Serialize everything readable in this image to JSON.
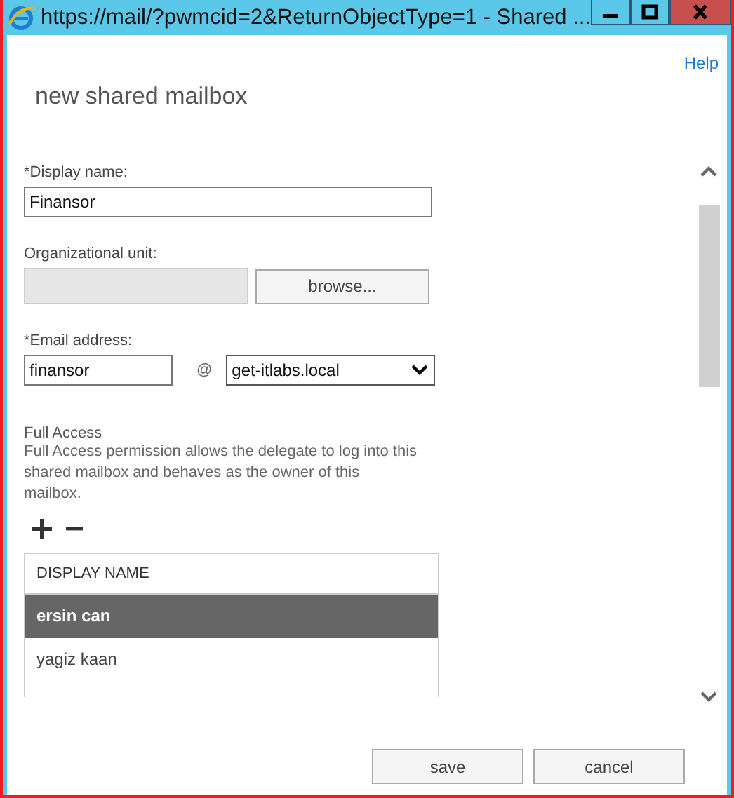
{
  "window": {
    "title": "https://mail/?pwmcid=2&ReturnObjectType=1 - Shared ..."
  },
  "help_link": "Help",
  "heading": "new shared mailbox",
  "display_name": {
    "label": "*Display name:",
    "value": "Finansor"
  },
  "organizational_unit": {
    "label": "Organizational unit:",
    "button": "browse..."
  },
  "email": {
    "label": "*Email address:",
    "value": "finansor",
    "at": "@",
    "domain": "get-itlabs.local"
  },
  "full_access": {
    "title": "Full Access",
    "description": "Full Access permission allows the delegate to log into this shared mailbox and behaves as the owner of this mailbox.",
    "list": {
      "column": "DISPLAY NAME",
      "rows": [
        {
          "name": "ersin can",
          "selected": true
        },
        {
          "name": "yagiz kaan",
          "selected": false
        }
      ]
    }
  },
  "buttons": [
    "save",
    "cancel"
  ]
}
